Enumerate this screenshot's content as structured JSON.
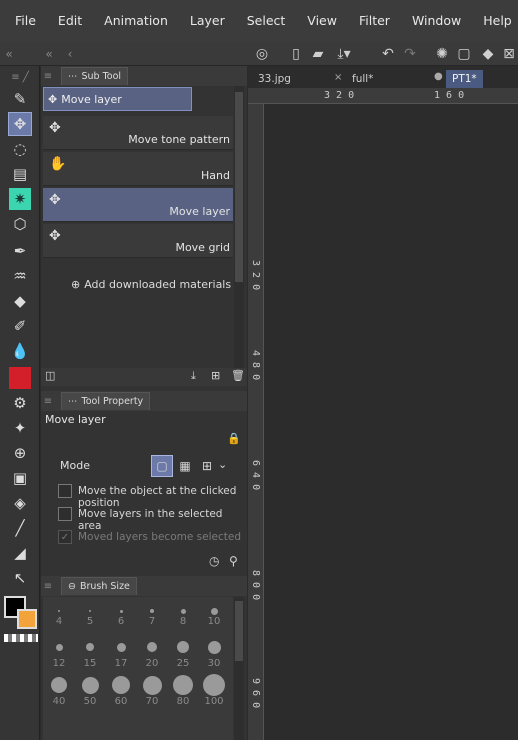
{
  "menu": [
    "File",
    "Edit",
    "Animation",
    "Layer",
    "Select",
    "View",
    "Filter",
    "Window",
    "Help"
  ],
  "tabs": {
    "sub_tool": "Sub Tool",
    "tool_property": "Tool Property",
    "brush_size": "Brush Size"
  },
  "sub_tool": {
    "header": "Move layer",
    "items": [
      {
        "label": "Move tone pattern",
        "icon": "move-cross-icon",
        "selected": false
      },
      {
        "label": "Hand",
        "icon": "hand-icon",
        "selected": false
      },
      {
        "label": "Move layer",
        "icon": "move-cross-icon",
        "selected": true
      },
      {
        "label": "Move grid",
        "icon": "move-cross-icon",
        "selected": false
      }
    ],
    "add_materials": "Add downloaded materials"
  },
  "tool_property": {
    "title": "Move layer",
    "mode_label": "Mode",
    "options": [
      {
        "label": "Move the object at the clicked position",
        "checked": false,
        "enabled": true
      },
      {
        "label": "Move layers in the selected area",
        "checked": false,
        "enabled": true
      },
      {
        "label": "Moved layers become selected",
        "checked": true,
        "enabled": false
      }
    ]
  },
  "brush_sizes": [
    "4",
    "5",
    "6",
    "7",
    "8",
    "10",
    "12",
    "15",
    "17",
    "20",
    "25",
    "30",
    "40",
    "50",
    "60",
    "70",
    "80",
    "100"
  ],
  "doc_tabs": [
    "33.jpg",
    "full*",
    "PT1*"
  ],
  "ruler": {
    "h": [
      "3 2 0",
      "1 6 0"
    ],
    "v": [
      "3 2 0",
      "4 8 0",
      "6 4 0",
      "8 0 0",
      "9 6 0"
    ]
  },
  "colors": {
    "main": "#000000",
    "sub": "#f2a33a",
    "accent": "#6b7aa8"
  }
}
